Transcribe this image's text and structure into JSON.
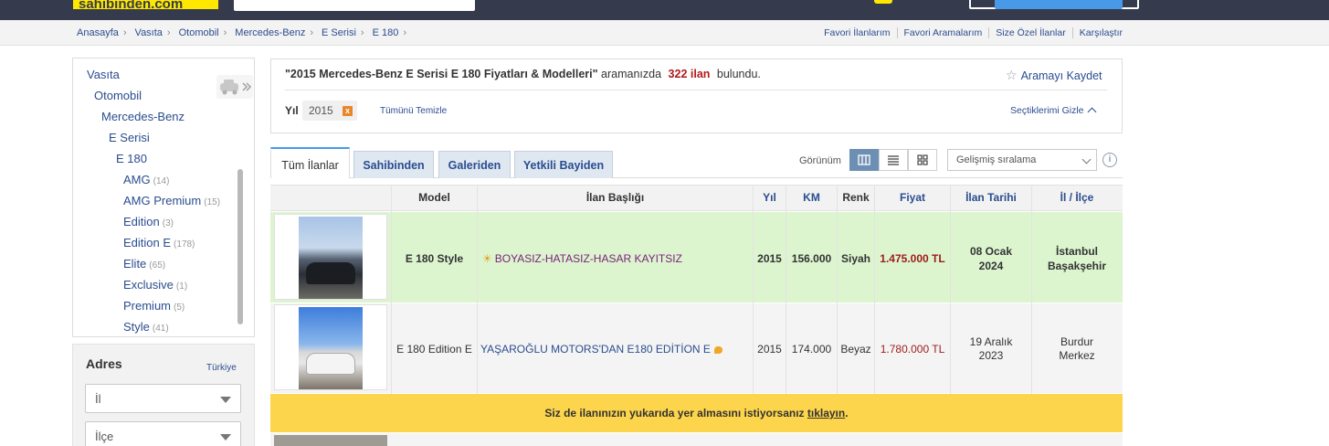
{
  "header": {
    "logo_text": "sahibinden.com"
  },
  "breadcrumb": [
    "Anasayfa",
    "Vasıta",
    "Otomobil",
    "Mercedes-Benz",
    "E Serisi",
    "E 180"
  ],
  "top_links": [
    "Favori İlanlarım",
    "Favori Aramalarım",
    "Size Özel İlanlar",
    "Karşılaştır"
  ],
  "categories": {
    "levels": [
      "Vasıta",
      "Otomobil",
      "Mercedes-Benz",
      "E Serisi",
      "E 180"
    ],
    "subitems": [
      {
        "label": "AMG",
        "count": "(14)"
      },
      {
        "label": "AMG Premium",
        "count": "(15)"
      },
      {
        "label": "Edition",
        "count": "(3)"
      },
      {
        "label": "Edition E",
        "count": "(178)"
      },
      {
        "label": "Elite",
        "count": "(65)"
      },
      {
        "label": "Exclusive",
        "count": "(1)"
      },
      {
        "label": "Premium",
        "count": "(5)"
      },
      {
        "label": "Style",
        "count": "(41)"
      }
    ]
  },
  "address": {
    "title": "Adres",
    "country": "Türkiye",
    "city_placeholder": "İl",
    "district_placeholder": "İlçe"
  },
  "summary": {
    "query": "\"2015 Mercedes-Benz E Serisi E 180 Fiyatları & Modelleri\"",
    "mid_text": "aramanızda",
    "count": "322 ilan",
    "end_text": "bulundu.",
    "save_search": "Aramayı Kaydet",
    "filter_label": "Yıl",
    "filter_value": "2015",
    "filter_remove": "x",
    "clear_all": "Tümünü Temizle",
    "hide_selected": "Seçtiklerimi Gizle"
  },
  "tabs": [
    "Tüm İlanlar",
    "Sahibinden",
    "Galeriden",
    "Yetkili Bayiden"
  ],
  "view": {
    "label": "Görünüm",
    "sort_value": "Gelişmiş sıralama",
    "info": "i"
  },
  "table": {
    "headers": [
      "Model",
      "İlan Başlığı",
      "Yıl",
      "KM",
      "Renk",
      "Fiyat",
      "İlan Tarihi",
      "İl / İlçe"
    ],
    "rows": [
      {
        "model": "E 180 Style",
        "title": "BOYASIZ-HATASIZ-HASAR KAYITSIZ",
        "year": "2015",
        "km": "156.000",
        "color": "Siyah",
        "price": "1.475.000 TL",
        "date_day": "08 Ocak",
        "date_year": "2024",
        "city": "İstanbul",
        "district": "Başakşehir"
      },
      {
        "model": "E 180 Edition E",
        "title": "YAŞAROĞLU MOTORS'DAN E180 EDİTİON E",
        "year": "2015",
        "km": "174.000",
        "color": "Beyaz",
        "price": "1.780.000 TL",
        "date_day": "19 Aralık",
        "date_year": "2023",
        "city": "Burdur",
        "district": "Merkez"
      }
    ]
  },
  "ad_banner": {
    "text": "Siz de ilanınızın yukarıda yer almasını istiyorsanız",
    "link": "tıklayın",
    "end": "."
  },
  "colors": {
    "header_bg": "#363a4d",
    "logo_yellow": "#ffe800",
    "link_blue": "#2a4d8f",
    "price_red": "#9e1b1b",
    "highlight_green": "#dcf5cf",
    "banner_yellow": "#fdd54c"
  }
}
